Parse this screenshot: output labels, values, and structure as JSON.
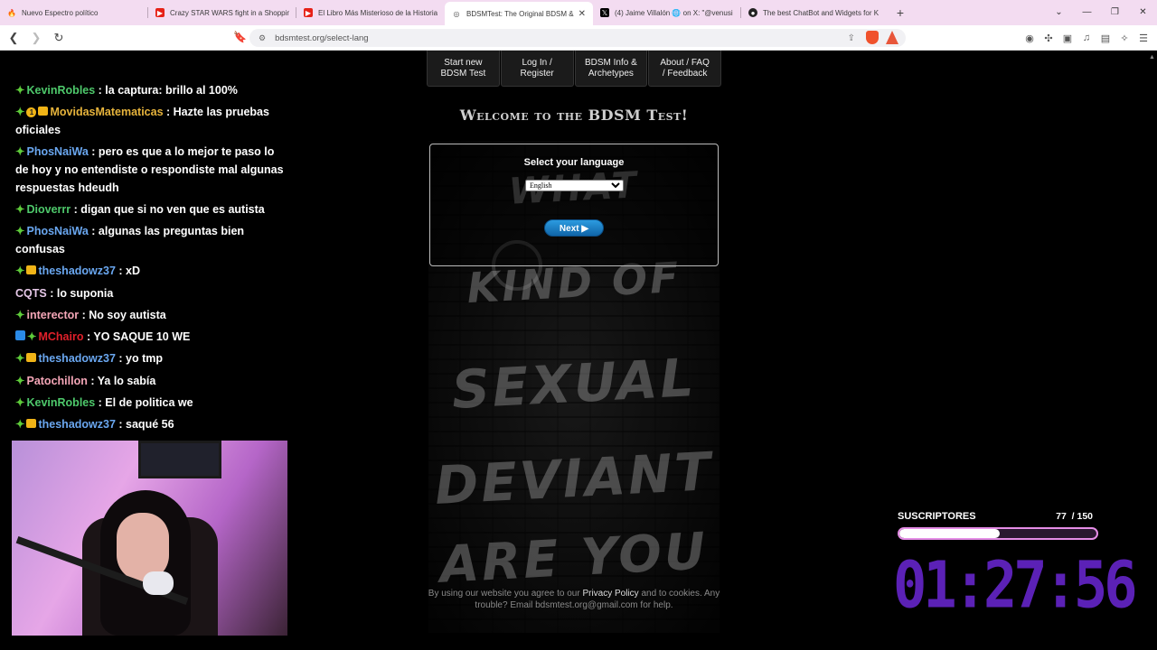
{
  "tabs": [
    {
      "label": "Nuevo Espectro político",
      "icon": "fire-icon",
      "color": "#ef6c00"
    },
    {
      "label": "Crazy STAR WARS fight in a Shopping",
      "icon": "youtube-icon",
      "color": "#e62117"
    },
    {
      "label": "El Libro Más Misterioso de la Historia",
      "icon": "youtube-icon",
      "color": "#e62117"
    },
    {
      "label": "BDSMTest: The Original BDSM &",
      "icon": "globe-icon",
      "color": "#555555",
      "active": true
    },
    {
      "label": "(4) Jaime Villalón 🌐 on X: \"@venusi",
      "icon": "x-icon",
      "color": "#000000"
    },
    {
      "label": "The best ChatBot and Widgets for K",
      "icon": "github-icon",
      "color": "#222222"
    }
  ],
  "url": "bdsmtest.org/select-lang",
  "site": {
    "nav": [
      {
        "line1": "Start new",
        "line2": "BDSM Test"
      },
      {
        "line1": "Log In /",
        "line2": "Register"
      },
      {
        "line1": "BDSM Info &",
        "line2": "Archetypes"
      },
      {
        "line1": "About / FAQ",
        "line2": "/ Feedback"
      }
    ],
    "welcome": "Welcome to the BDSM Test!",
    "graffiti": [
      "WHAT",
      "KIND OF",
      "SEXUAL",
      "DEVIANT",
      "ARE YOU"
    ],
    "select_label": "Select your language",
    "language_selected": "English",
    "next_label": "Next ▶",
    "footer_1": "By using our website you agree to our ",
    "footer_privacy": "Privacy Policy",
    "footer_2": " and to cookies. Any trouble? Email bdsmtest.org@gmail.com for help."
  },
  "chat": [
    {
      "user": "KevinRobles",
      "text": " : la captura: brillo al 100%",
      "color": "green",
      "badges": [
        "g"
      ]
    },
    {
      "user": "MovidasMatematicas",
      "text": " : Hazte las pruebas oficiales",
      "color": "gold",
      "badges": [
        "g",
        "o",
        "c"
      ],
      "badge_num": "1"
    },
    {
      "user": "PhosNaiWa",
      "text": " : pero es que a lo mejor te paso lo de hoy y no entendiste o respondiste mal algunas respuestas hdeudh",
      "color": "blue",
      "badges": [
        "g"
      ]
    },
    {
      "user": "Dioverrr",
      "text": " : digan que si no ven que es autista",
      "color": "green",
      "badges": [
        "g"
      ]
    },
    {
      "user": "PhosNaiWa",
      "text": " : algunas las preguntas bien confusas",
      "color": "blue",
      "badges": [
        "g"
      ]
    },
    {
      "user": "theshadowz37",
      "text": " : xD",
      "color": "blue",
      "badges": [
        "g",
        "c"
      ]
    },
    {
      "user": "CQTS",
      "text": " : lo suponia",
      "color": "pink",
      "badges": []
    },
    {
      "user": "interector",
      "text": " : No soy autista",
      "color": "orange",
      "badges": [
        "g"
      ]
    },
    {
      "user": "MChairo",
      "text": " : YO SAQUE 10 WE",
      "color": "red",
      "badges": [
        "b",
        "g"
      ]
    },
    {
      "user": "theshadowz37",
      "text": " : yo tmp",
      "color": "blue",
      "badges": [
        "g",
        "c"
      ]
    },
    {
      "user": "Patochillon",
      "text": " : Ya lo sabía",
      "color": "orange",
      "badges": [
        "g"
      ]
    },
    {
      "user": "KevinRobles",
      "text": " : El de politica we",
      "color": "green",
      "badges": [
        "g"
      ]
    },
    {
      "user": "theshadowz37",
      "text": " : saqué 56",
      "color": "blue",
      "badges": [
        "g",
        "c"
      ]
    }
  ],
  "subgoal": {
    "label": "SUSCRIPTORES",
    "current": "77",
    "total": "/ 150",
    "progress": 0.51
  },
  "timer": "01:27:56"
}
